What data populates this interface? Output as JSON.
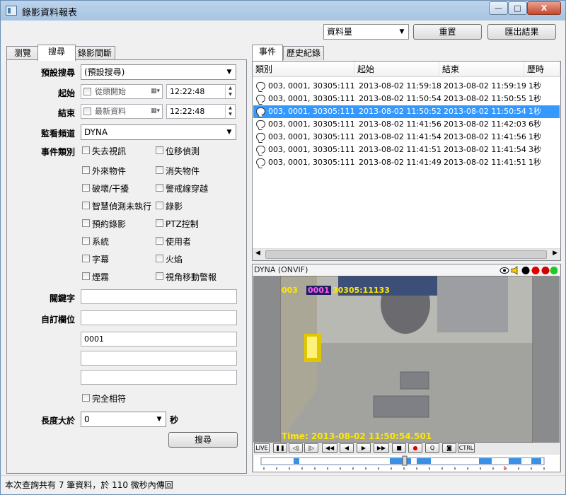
{
  "window": {
    "title": "錄影資料報表"
  },
  "titlebar_buttons": {
    "minimize": "—",
    "maximize": "□",
    "close": "X"
  },
  "toolbar": {
    "data_select": "資料量",
    "reset": "重置",
    "export": "匯出結果"
  },
  "left_tabs": [
    "瀏覽",
    "搜尋",
    "錄影間斷"
  ],
  "form": {
    "preset_label": "預設搜尋",
    "preset_value": "(預設搜尋)",
    "start_label": "起始",
    "start_date": "從頭開始",
    "start_time": "12:22:48",
    "end_label": "結束",
    "end_date": "最新資料",
    "end_time": "12:22:48",
    "channel_label": "監看頻道",
    "channel_value": "DYNA",
    "event_label": "事件類別",
    "events": [
      "失去視訊",
      "位移偵測",
      "外來物件",
      "消失物件",
      "破壞/干擾",
      "警戒線穿越",
      "智慧偵測未執行",
      "錄影",
      "預約錄影",
      "PTZ控制",
      "系統",
      "使用者",
      "字幕",
      "火焰",
      "煙霧",
      "視角移動警報"
    ],
    "keyword_label": "關鍵字",
    "keyword_value": "",
    "custom_label": "自訂欄位",
    "custom_values": [
      "",
      "0001",
      "",
      ""
    ],
    "exact_match": "完全相符",
    "length_label": "長度大於",
    "length_value": "0",
    "length_unit": "秒",
    "search_button": "搜尋"
  },
  "right_tabs": [
    "事件",
    "歷史紀錄"
  ],
  "table": {
    "headers": [
      "類別",
      "起始",
      "結束",
      "歷時"
    ],
    "rows": [
      {
        "category": "003, 0001, 30305:111...",
        "start": "2013-08-02 11:59:18",
        "end": "2013-08-02 11:59:19",
        "duration": "1秒"
      },
      {
        "category": "003, 0001, 30305:111...",
        "start": "2013-08-02 11:50:54",
        "end": "2013-08-02 11:50:55",
        "duration": "1秒"
      },
      {
        "category": "003, 0001, 30305:111...",
        "start": "2013-08-02 11:50:52",
        "end": "2013-08-02 11:50:54",
        "duration": "1秒"
      },
      {
        "category": "003, 0001, 30305:111...",
        "start": "2013-08-02 11:41:56",
        "end": "2013-08-02 11:42:03",
        "duration": "6秒"
      },
      {
        "category": "003, 0001, 30305:111...",
        "start": "2013-08-02 11:41:54",
        "end": "2013-08-02 11:41:56",
        "duration": "1秒"
      },
      {
        "category": "003, 0001, 30305:111...",
        "start": "2013-08-02 11:41:51",
        "end": "2013-08-02 11:41:54",
        "duration": "3秒"
      },
      {
        "category": "003, 0001, 30305:111...",
        "start": "2013-08-02 11:41:49",
        "end": "2013-08-02 11:41:51",
        "duration": "1秒"
      }
    ],
    "selected_row": 2
  },
  "video": {
    "title": "DYNA (ONVIF)",
    "overlay_id": "003",
    "overlay_code": "0001",
    "overlay_text": "30305:11133",
    "timestamp": "Time: 2013-08-02 11:50:54.501"
  },
  "controls": {
    "live": "LIVE",
    "ctrl": "CTRL"
  },
  "status": {
    "text": "本次查詢共有 7 筆資料，於 110 微秒內傳回"
  },
  "colors": {
    "selection": "#3399ff",
    "titlebar": "#b9d1ea",
    "timeline_block": "#3a8fe6",
    "overlay_yellow": "#ffe800",
    "overlay_magenta": "#ff5cf0"
  }
}
